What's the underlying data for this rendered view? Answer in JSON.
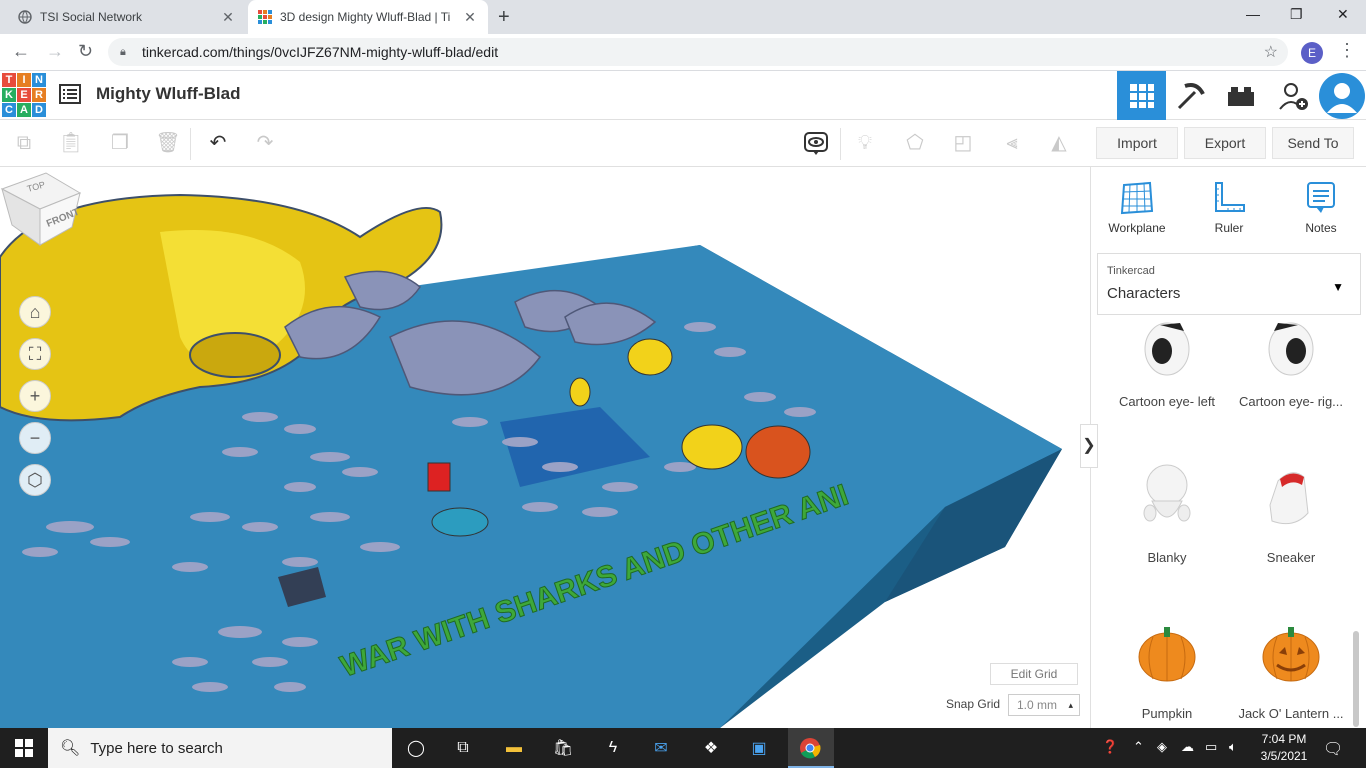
{
  "browser": {
    "tabs": [
      {
        "title": "TSI Social Network",
        "active": false
      },
      {
        "title": "3D design Mighty Wluff-Blad | Ti",
        "active": true
      }
    ],
    "url": "tinkercad.com/things/0vcIJFZ67NM-mighty-wluff-blad/edit",
    "profile_initial": "E"
  },
  "app": {
    "logo_letters": [
      "T",
      "I",
      "N",
      "K",
      "E",
      "R",
      "C",
      "A",
      "D"
    ],
    "logo_colors": [
      "#e74c3c",
      "#e67e22",
      "#2a8fd9",
      "#27ae60",
      "#e74c3c",
      "#e67e22",
      "#2a8fd9",
      "#27ae60",
      "#2a8fd9"
    ],
    "design_title": "Mighty Wluff-Blad",
    "header_buttons": [
      "3d-design-view",
      "codeblocks",
      "bricks",
      "add-user",
      "account"
    ]
  },
  "toolbar": {
    "import_label": "Import",
    "export_label": "Export",
    "send_to_label": "Send To"
  },
  "viewport": {
    "navcube_top": "TOP",
    "navcube_front": "FRONT",
    "scene_text": "WAR WITH SHARKS AND OTHER ANI",
    "edit_grid_label": "Edit Grid",
    "snap_grid_label": "Snap Grid",
    "snap_grid_value": "1.0 mm",
    "colors": {
      "plate_top": "#2f7fae",
      "plate_side": "#1b5e86",
      "grid": "#1e5fa8",
      "yellow": "#f2d21a",
      "shark": "#8a93b8",
      "text_green": "#3ea83a"
    }
  },
  "panel": {
    "tools": [
      {
        "label": "Workplane",
        "icon": "workplane-icon"
      },
      {
        "label": "Ruler",
        "icon": "ruler-icon"
      },
      {
        "label": "Notes",
        "icon": "notes-icon"
      }
    ],
    "source_label": "Tinkercad",
    "category": "Characters",
    "shapes": [
      {
        "label": "Cartoon eye- left"
      },
      {
        "label": "Cartoon eye- rig..."
      },
      {
        "label": "Blanky"
      },
      {
        "label": "Sneaker"
      },
      {
        "label": "Pumpkin"
      },
      {
        "label": "Jack O' Lantern ..."
      }
    ]
  },
  "taskbar": {
    "search_placeholder": "Type here to search",
    "time": "7:04 PM",
    "date": "3/5/2021"
  }
}
